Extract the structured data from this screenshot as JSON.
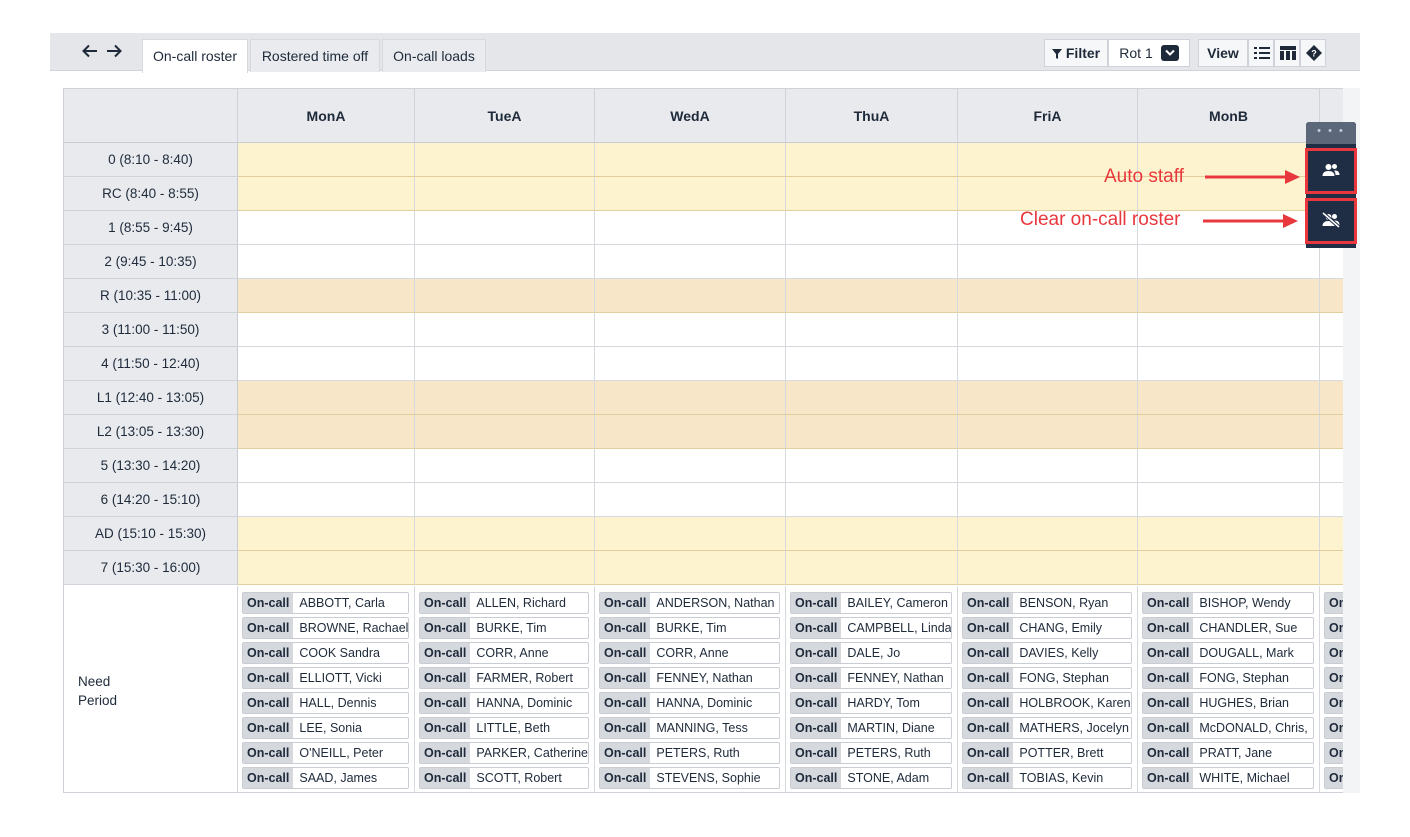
{
  "toolbar": {
    "back_icon": "arrow-left-icon",
    "forward_icon": "arrow-right-icon",
    "tabs": [
      {
        "label": "On-call roster",
        "active": true
      },
      {
        "label": "Rostered time off",
        "active": false
      },
      {
        "label": "On-call loads",
        "active": false
      }
    ],
    "filter_label": "Filter",
    "rotation_value": "Rot 1",
    "view_label": "View",
    "view_icons": [
      "list-view-icon",
      "table-view-icon",
      "help-icon"
    ]
  },
  "columns": [
    "MonA",
    "TueA",
    "WedA",
    "ThuA",
    "FriA",
    "MonB"
  ],
  "periods": [
    {
      "label": "0  (8:10 - 8:40)",
      "kind": "admin"
    },
    {
      "label": "RC  (8:40 - 8:55)",
      "kind": "admin"
    },
    {
      "label": "1  (8:55 - 9:45)",
      "kind": "class"
    },
    {
      "label": "2  (9:45 - 10:35)",
      "kind": "class"
    },
    {
      "label": "R  (10:35 - 11:00)",
      "kind": "break"
    },
    {
      "label": "3  (11:00 - 11:50)",
      "kind": "class"
    },
    {
      "label": "4  (11:50 - 12:40)",
      "kind": "class"
    },
    {
      "label": "L1  (12:40 - 13:05)",
      "kind": "break"
    },
    {
      "label": "L2  (13:05 - 13:30)",
      "kind": "break"
    },
    {
      "label": "5  (13:30 - 14:20)",
      "kind": "class"
    },
    {
      "label": "6  (14:20 - 15:10)",
      "kind": "class"
    },
    {
      "label": "AD  (15:10 - 15:30)",
      "kind": "admin"
    },
    {
      "label": "7  (15:30 - 16:00)",
      "kind": "admin"
    }
  ],
  "need_period_label": [
    "Need",
    "Period"
  ],
  "chip_tag": "On-call",
  "need_lists": [
    [
      "ABBOTT, Carla",
      "BROWNE, Rachael",
      "COOK Sandra",
      "ELLIOTT, Vicki",
      "HALL, Dennis",
      "LEE, Sonia",
      "O'NEILL, Peter",
      "SAAD, James"
    ],
    [
      "ALLEN, Richard",
      "BURKE, Tim",
      "CORR, Anne",
      "FARMER, Robert",
      "HANNA, Dominic",
      "LITTLE, Beth",
      "PARKER, Catherine",
      "SCOTT, Robert"
    ],
    [
      "ANDERSON, Nathan",
      "BURKE, Tim",
      "CORR, Anne",
      "FENNEY, Nathan",
      "HANNA, Dominic",
      "MANNING, Tess",
      "PETERS, Ruth",
      "STEVENS, Sophie"
    ],
    [
      "BAILEY, Cameron",
      "CAMPBELL, Linda",
      "DALE, Jo",
      "FENNEY, Nathan",
      "HARDY, Tom",
      "MARTIN, Diane",
      "PETERS, Ruth",
      "STONE, Adam"
    ],
    [
      "BENSON, Ryan",
      "CHANG, Emily",
      "DAVIES, Kelly",
      "FONG, Stephan",
      "HOLBROOK, Karen",
      "MATHERS, Jocelyn",
      "POTTER, Brett",
      "TOBIAS, Kevin"
    ],
    [
      "BISHOP, Wendy",
      "CHANDLER, Sue",
      "DOUGALL, Mark",
      "FONG, Stephan",
      "HUGHES, Brian",
      "McDONALD, Chris,",
      "PRATT, Jane",
      "WHITE, Michael"
    ]
  ],
  "partial_chip_tag": "On",
  "side_panel": {
    "handle_text": "• • •",
    "auto_staff_icon": "users-icon",
    "clear_roster_icon": "users-slash-icon"
  },
  "annotations": {
    "auto_staff": "Auto staff",
    "clear_roster": "Clear on-call roster",
    "color": "#e8383d"
  },
  "colors": {
    "admin_row": "#fdf4cf",
    "break_row": "#f8e6c8",
    "class_row": "#ffffff",
    "dark_navy": "#1f2d45",
    "highlight": "#e8383d"
  }
}
